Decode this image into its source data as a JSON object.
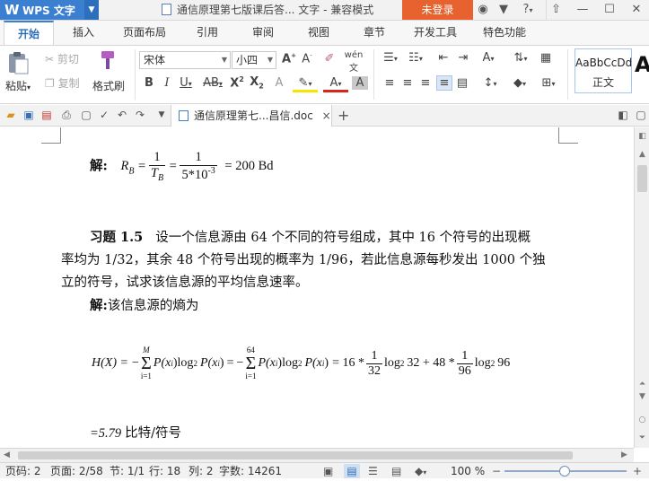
{
  "titlebar": {
    "app_logo": "W",
    "app_name": "WPS 文字",
    "doc_title": "通信原理第七版课后答... 文字 - 兼容模式",
    "login_label": "未登录",
    "help_label": "?",
    "icons": [
      "skin-icon",
      "shirt-icon",
      "help-icon",
      "collapse-icon",
      "minimize-icon",
      "maximize-icon",
      "close-icon"
    ]
  },
  "tabs": [
    "开始",
    "插入",
    "页面布局",
    "引用",
    "审阅",
    "视图",
    "章节",
    "开发工具",
    "特色功能"
  ],
  "active_tab": "开始",
  "ribbon": {
    "paste_label": "粘贴",
    "cut_label": "剪切",
    "copy_label": "复制",
    "format_painter_label": "格式刷",
    "font_name": "宋体",
    "font_size": "小四",
    "style_preview": "AaBbCcDd",
    "style_name": "正文",
    "style_next_preview": "A"
  },
  "quick_access": {
    "doc_tab_label": "通信原理第七...昌信.doc",
    "close_glyph": "×",
    "new_tab_glyph": "+"
  },
  "document": {
    "ans1_label": "解:",
    "ans1_formula_start": "R",
    "ans1_formula_sub": "B",
    "ans1_frac1_num": "1",
    "ans1_frac1_den": "T",
    "ans1_frac1_den_sub": "B",
    "ans1_frac2_num": "1",
    "ans1_frac2_den": "5*10",
    "ans1_frac2_den_exp": "-3",
    "ans1_result": "= 200 Bd",
    "exercise_label": "习题 1.5",
    "exercise_line1": "设一个信息源由 64 个不同的符号组成，其中 16 个符号的出现概",
    "exercise_line2": "率均为 1/32，其余 48 个符号出现的概率为 1/96，若此信息源每秒发出 1000 个独",
    "exercise_line3": "立的符号，试求该信息源的平均信息速率。",
    "ans2_label": "解:",
    "ans2_text": "该信息源的熵为",
    "entropy_lhs": "H(X) =",
    "sum1_top": "M",
    "sum1_bottom": "i=1",
    "sum_term": "P(x",
    "sum_term_close": ")log",
    "log_sub": "2",
    "sum2_top": "64",
    "sum2_bottom": "i=1",
    "rhs_coef1": "= 16 *",
    "rhs_frac1_num": "1",
    "rhs_frac1_den": "32",
    "rhs_log1_arg": "32 + 48 *",
    "rhs_frac2_num": "1",
    "rhs_frac2_den": "96",
    "rhs_log2_arg": "96",
    "result_value": "=5.79",
    "result_unit": "比特/符号"
  },
  "statusbar": {
    "page_num": "页码: 2",
    "page": "页面: 2/58",
    "section": "节: 1/1",
    "row": "行: 18",
    "col": "列: 2",
    "word_count": "字数: 14261",
    "zoom": "100 %"
  }
}
